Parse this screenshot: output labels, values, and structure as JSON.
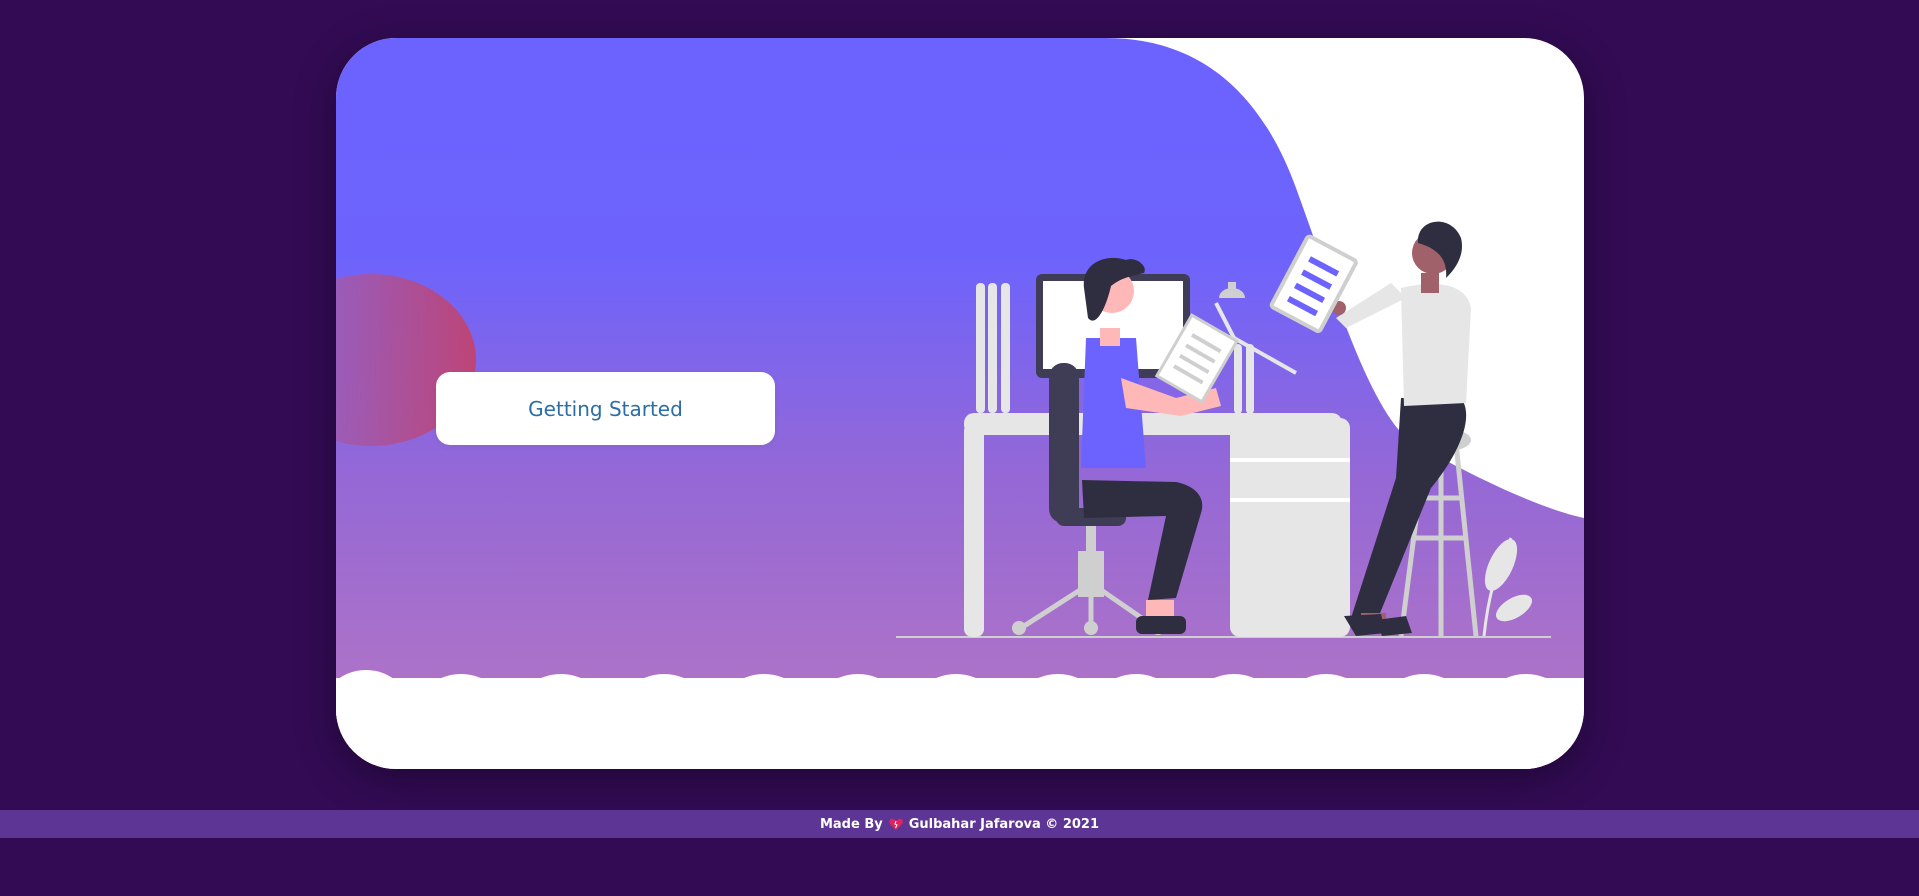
{
  "hero": {
    "button_label": "Getting Started",
    "gradient_top": "#6c63ff",
    "gradient_bottom": "#b777c2",
    "accent_purple": "#6c63ff",
    "blob_color": "#c4416a"
  },
  "footer": {
    "made_by_label": "Made By",
    "heart_icon": "broken-heart-icon",
    "author_text": "Gulbahar Jafarova © 2021",
    "background": "#5d3595"
  },
  "illustration": {
    "name": "people-working-at-desk-illustration"
  }
}
